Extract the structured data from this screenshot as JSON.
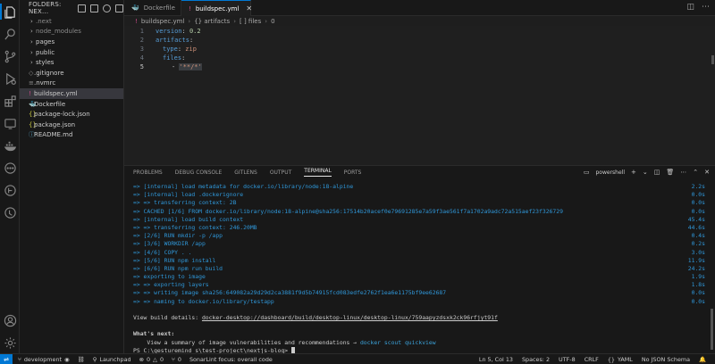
{
  "explorer": {
    "title": "FOLDERS: NEX...",
    "items": [
      {
        "label": ".next",
        "type": "folder",
        "dim": true
      },
      {
        "label": "node_modules",
        "type": "folder",
        "dim": true
      },
      {
        "label": "pages",
        "type": "folder"
      },
      {
        "label": "public",
        "type": "folder"
      },
      {
        "label": "styles",
        "type": "folder"
      },
      {
        "label": ".gitignore",
        "type": "file",
        "icon": "◇",
        "color": "#8b8b8b"
      },
      {
        "label": ".nvmrc",
        "type": "file",
        "icon": "≡",
        "color": "#8b8b8b"
      },
      {
        "label": "buildspec.yml",
        "type": "file",
        "icon": "!",
        "color": "#cb4b89",
        "selected": true
      },
      {
        "label": "Dockerfile",
        "type": "file",
        "icon": "🐳",
        "color": "#2496ed"
      },
      {
        "label": "package-lock.json",
        "type": "file",
        "icon": "{}",
        "color": "#cbcb41"
      },
      {
        "label": "package.json",
        "type": "file",
        "icon": "{}",
        "color": "#cbcb41"
      },
      {
        "label": "README.md",
        "type": "file",
        "icon": "ⓘ",
        "color": "#519aba"
      }
    ]
  },
  "tabs": [
    {
      "label": "Dockerfile",
      "icon": "🐳",
      "active": false
    },
    {
      "label": "buildspec.yml",
      "icon": "!",
      "active": true,
      "close": "✕"
    }
  ],
  "breadcrumb": [
    "buildspec.yml",
    "{} artifacts",
    "[ ] files",
    "0"
  ],
  "code": [
    {
      "n": "1",
      "key": "version",
      "val": "0.2"
    },
    {
      "n": "2",
      "key": "artifacts",
      "val": ""
    },
    {
      "n": "3",
      "key": "type",
      "val": "zip"
    },
    {
      "n": "4",
      "key": "files",
      "val": ""
    },
    {
      "n": "5",
      "dash": "- ",
      "val": "'**/*'"
    }
  ],
  "panel": {
    "tabs": [
      "PROBLEMS",
      "DEBUG CONSOLE",
      "GITLENS",
      "OUTPUT",
      "TERMINAL",
      "PORTS"
    ],
    "shell": "powershell"
  },
  "terminal": {
    "steps": [
      {
        "text": "=> [internal] load metadata for docker.io/library/node:18-alpine",
        "time": "2.2s"
      },
      {
        "text": "=> [internal] load .dockerignore",
        "time": "0.0s"
      },
      {
        "text": "=> => transferring context: 2B",
        "time": "0.0s"
      },
      {
        "text": "=> CACHED [1/6] FROM docker.io/library/node:18-alpine@sha256:17514b20acef0e79691285e7a59f3ae561f7a1702a9adc72a515aef23f326729",
        "time": "0.0s"
      },
      {
        "text": "=> [internal] load build context",
        "time": "45.4s"
      },
      {
        "text": "=> => transferring context: 246.20MB",
        "time": "44.6s"
      },
      {
        "text": "=> [2/6] RUN mkdir -p /app",
        "time": "0.4s"
      },
      {
        "text": "=> [3/6] WORKDIR /app",
        "time": "0.2s"
      },
      {
        "text": "=> [4/6] COPY . .",
        "time": "3.0s"
      },
      {
        "text": "=> [5/6] RUN npm install",
        "time": "11.9s"
      },
      {
        "text": "=> [6/6] RUN npm run build",
        "time": "24.2s"
      },
      {
        "text": "=> exporting to image",
        "time": "1.9s"
      },
      {
        "text": "=> => exporting layers",
        "time": "1.8s"
      },
      {
        "text": "=> => writing image sha256:649082a29d29d2ca3881f9d5b74915fcd083edfe2762f1ea6e1175bf9ee62687",
        "time": "0.0s"
      },
      {
        "text": "=> => naming to docker.io/library/testapp",
        "time": "0.0s"
      }
    ],
    "view_details_label": "View build details: ",
    "view_details_link": "docker-desktop://dashboard/build/desktop-linux/desktop-linux/759aapyzdsxk2ck96rfjyt91f",
    "whats_next": "What's next:",
    "summary_text": "View a summary of image vulnerabilities and recommendations → ",
    "summary_cmd": "docker scout quickview",
    "prompt": "PS C:\\gesturemind s\\test-project\\nextjs-blog> "
  },
  "status": {
    "branch": "development",
    "launchpad": "Launchpad",
    "errors": "0",
    "warnings": "0",
    "ports": "0",
    "sonarlint": "SonarLint focus: overall code",
    "position": "Ln 5, Col 13",
    "spaces": "Spaces: 2",
    "encoding": "UTF-8",
    "eol": "CRLF",
    "language": "YAML",
    "schema": "No JSON Schema"
  },
  "colors": {
    "accent": "#0078d4",
    "terminal_blue": "#2f97d9"
  }
}
